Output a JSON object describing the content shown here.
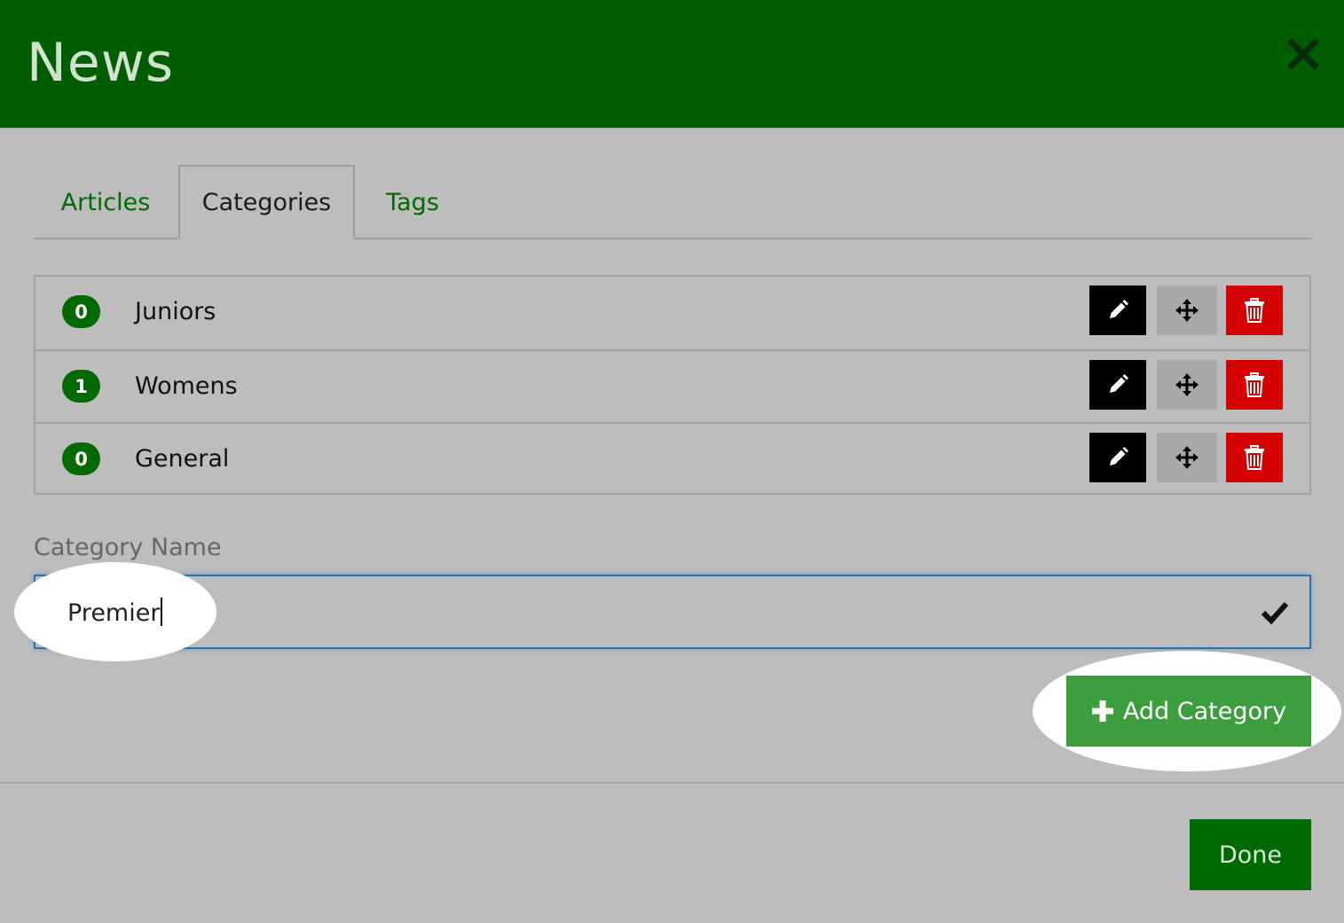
{
  "dialog": {
    "title": "News",
    "close_icon": "close-icon"
  },
  "tabs": [
    {
      "label": "Articles",
      "active": false
    },
    {
      "label": "Categories",
      "active": true
    },
    {
      "label": "Tags",
      "active": false
    }
  ],
  "categories": [
    {
      "count": "0",
      "name": "Juniors"
    },
    {
      "count": "1",
      "name": "Womens"
    },
    {
      "count": "0",
      "name": "General"
    }
  ],
  "row_actions": {
    "edit_icon": "pencil-icon",
    "move_icon": "move-arrows-icon",
    "delete_icon": "trash-icon"
  },
  "form": {
    "label": "Category Name",
    "value": "Premier",
    "confirm_icon": "checkmark-icon"
  },
  "buttons": {
    "add_label": "Add Category",
    "add_icon": "plus-icon",
    "done_label": "Done"
  },
  "colors": {
    "brand_green": "#005e00",
    "add_green": "#3d9e3d",
    "danger_red": "#d50000",
    "background": "#bdbdbd"
  }
}
